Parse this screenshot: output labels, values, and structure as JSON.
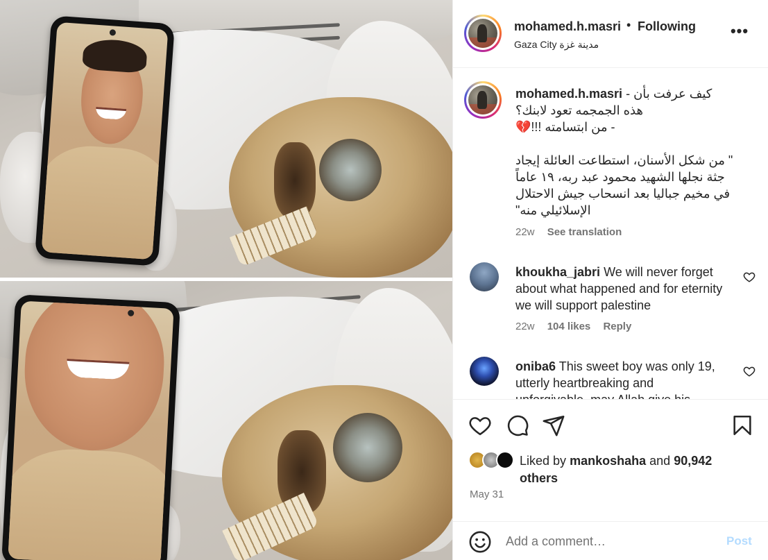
{
  "post": {
    "username": "mohamed.h.masri",
    "follow_status": "Following",
    "separator": "•",
    "location": "Gaza City مدينة غزة",
    "more_label": "•••"
  },
  "caption": {
    "username": "mohamed.h.masri",
    "lines": [
      "- كيف عرفت بأن",
      "هذه الجمجمه تعود لابنك؟",
      "- من ابتسامته !!!💔",
      "",
      "\" من شكل الأسنان، استطاعت العائلة إيجاد",
      "جثة نجلها الشهيد محمود عبد ربه، ١٩ عاماً",
      "في مخيم جباليا بعد انسحاب جيش الاحتلال",
      "الإسلائيلي منه\""
    ],
    "time": "22w",
    "translate_label": "See translation"
  },
  "comments": [
    {
      "username": "khoukha_jabri",
      "text": "We will never forget about what happened and for eternity we will support palestine",
      "time": "22w",
      "likes": "104 likes",
      "reply_label": "Reply"
    },
    {
      "username": "oniba6",
      "text": "This sweet boy was only 19, utterly heartbreaking and unforgivable, may Allah give his"
    }
  ],
  "likes": {
    "prefix": "Liked by",
    "user": "mankoshaha",
    "joiner": "and",
    "count": "90,942",
    "suffix": "others"
  },
  "date": "May 31",
  "composer": {
    "placeholder": "Add a comment…",
    "post_label": "Post"
  },
  "icons": {
    "like": "heart-icon",
    "comment": "comment-bubble-icon",
    "share": "paper-plane-icon",
    "save": "bookmark-icon",
    "emoji": "smiley-icon",
    "comment_like": "heart-outline-icon"
  },
  "colors": {
    "text": "#262626",
    "secondary": "#737373",
    "post_disabled": "#b3dbff",
    "divider": "#efefef"
  }
}
